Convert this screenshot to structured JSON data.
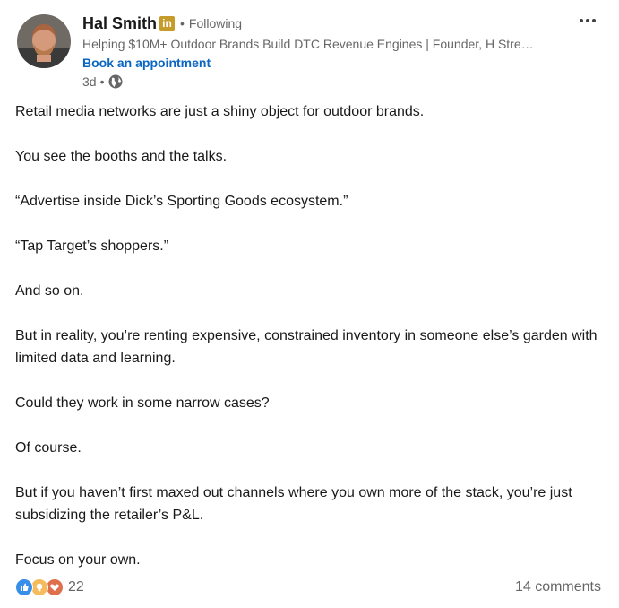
{
  "author": {
    "name": "Hal Smith",
    "badge": "in",
    "follow_status": "Following",
    "headline": "Helping $10M+ Outdoor Brands Build DTC Revenue Engines | Founder, H Stre…",
    "cta_label": "Book an appointment",
    "time_ago": "3d",
    "visibility_icon": "globe-icon"
  },
  "post": {
    "paragraphs": [
      "Retail media networks are just a shiny object for outdoor brands.",
      "You see the booths and the talks.",
      "“Advertise inside Dick’s Sporting Goods ecosystem.”",
      "“Tap Target’s shoppers.”",
      "And so on.",
      "But in reality, you’re renting expensive, constrained inventory in someone else’s garden with limited data and learning.",
      "Could they work in some narrow cases?",
      "Of course.",
      "But if you haven’t first maxed out channels where you own more of the stack, you’re just subsidizing the retailer’s P&L.",
      "Focus on your own."
    ]
  },
  "social": {
    "reaction_icons": [
      "like-icon",
      "insightful-icon",
      "love-icon"
    ],
    "reaction_count": "22",
    "comments_label": "14 comments"
  },
  "colors": {
    "accent": "#0a66c2",
    "secondary_text": "#666666",
    "badge": "#c59b2a",
    "like": "#378fe9",
    "insightful": "#f5bb5c",
    "love": "#df704d"
  }
}
